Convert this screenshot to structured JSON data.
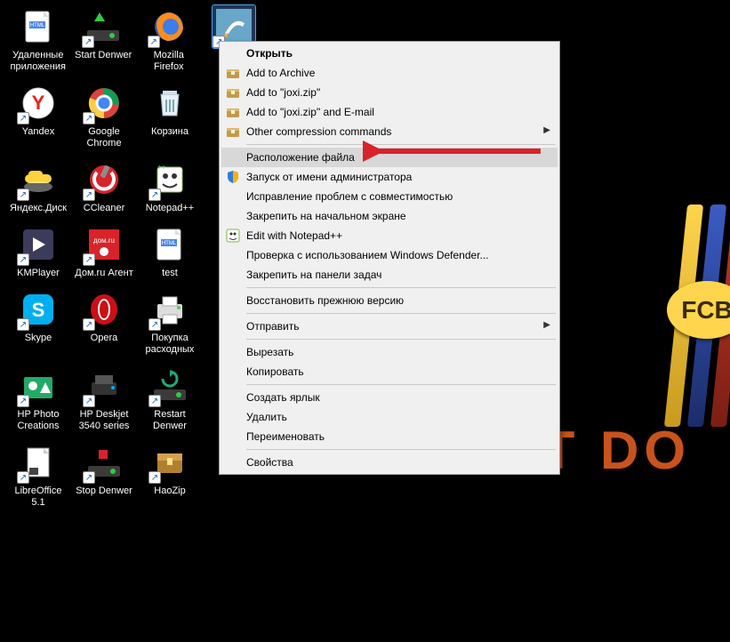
{
  "wallpaper": {
    "text": "JUST DO",
    "badge": "FCB"
  },
  "desktop": {
    "rows": [
      [
        {
          "label": "Удаленные приложения",
          "icon": "html-file",
          "shortcut": false
        },
        {
          "label": "Start Denwer",
          "icon": "denwer-start",
          "shortcut": true
        },
        {
          "label": "Mozilla Firefox",
          "icon": "firefox",
          "shortcut": true
        },
        {
          "label": "",
          "icon": "joxi",
          "shortcut": true,
          "selected": true
        }
      ],
      [
        {
          "label": "Yandex",
          "icon": "yandex",
          "shortcut": true
        },
        {
          "label": "Google Chrome",
          "icon": "chrome",
          "shortcut": true
        },
        {
          "label": "Корзина",
          "icon": "recycle-bin",
          "shortcut": false
        }
      ],
      [
        {
          "label": "Яндекс.Диск",
          "icon": "yadisk",
          "shortcut": true
        },
        {
          "label": "CCleaner",
          "icon": "ccleaner",
          "shortcut": true
        },
        {
          "label": "Notepad++",
          "icon": "notepadpp",
          "shortcut": true
        }
      ],
      [
        {
          "label": "KMPlayer",
          "icon": "kmplayer",
          "shortcut": true
        },
        {
          "label": "Дом.ru Агент",
          "icon": "domru",
          "shortcut": true
        },
        {
          "label": "test",
          "icon": "html-file",
          "shortcut": false
        }
      ],
      [
        {
          "label": "Skype",
          "icon": "skype",
          "shortcut": true
        },
        {
          "label": "Opera",
          "icon": "opera",
          "shortcut": true
        },
        {
          "label": "Покупка расходных",
          "icon": "printer",
          "shortcut": true
        }
      ],
      [
        {
          "label": "HP Photo Creations",
          "icon": "hpphoto",
          "shortcut": true
        },
        {
          "label": "HP Deskjet 3540 series",
          "icon": "hpprinter",
          "shortcut": true
        },
        {
          "label": "Restart Denwer",
          "icon": "denwer-restart",
          "shortcut": true
        }
      ],
      [
        {
          "label": "LibreOffice 5.1",
          "icon": "libreoffice",
          "shortcut": true
        },
        {
          "label": "Stop Denwer",
          "icon": "denwer-stop",
          "shortcut": true
        },
        {
          "label": "HaoZip",
          "icon": "haozip",
          "shortcut": true
        }
      ]
    ]
  },
  "contextMenu": {
    "items": [
      {
        "label": "Открыть",
        "bold": true
      },
      {
        "label": "Add to Archive",
        "icon": "archive"
      },
      {
        "label": "Add to \"joxi.zip\"",
        "icon": "archive"
      },
      {
        "label": "Add to \"joxi.zip\" and E-mail",
        "icon": "archive"
      },
      {
        "label": "Other compression commands",
        "icon": "archive",
        "submenu": true
      },
      {
        "sep": true
      },
      {
        "label": "Расположение файла",
        "hl": true
      },
      {
        "label": "Запуск от имени администратора",
        "icon": "shield"
      },
      {
        "label": "Исправление проблем с совместимостью"
      },
      {
        "label": "Закрепить на начальном экране"
      },
      {
        "label": "Edit with Notepad++",
        "icon": "notepadpp-small"
      },
      {
        "label": "Проверка с использованием Windows Defender..."
      },
      {
        "label": "Закрепить на панели задач"
      },
      {
        "sep": true
      },
      {
        "label": "Восстановить прежнюю версию"
      },
      {
        "sep": true
      },
      {
        "label": "Отправить",
        "submenu": true
      },
      {
        "sep": true
      },
      {
        "label": "Вырезать"
      },
      {
        "label": "Копировать"
      },
      {
        "sep": true
      },
      {
        "label": "Создать ярлык"
      },
      {
        "label": "Удалить"
      },
      {
        "label": "Переименовать"
      },
      {
        "sep": true
      },
      {
        "label": "Свойства"
      }
    ]
  }
}
